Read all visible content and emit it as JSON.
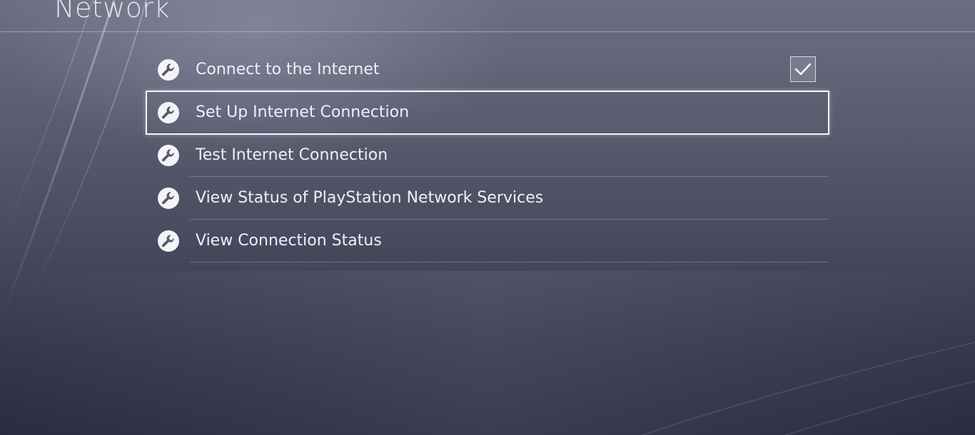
{
  "page": {
    "title": "Network"
  },
  "menu": {
    "items": [
      {
        "label": "Connect to the Internet",
        "icon": "wrench-icon",
        "checked": true
      },
      {
        "label": "Set Up Internet Connection",
        "icon": "wrench-icon",
        "selected": true
      },
      {
        "label": "Test Internet Connection",
        "icon": "wrench-icon"
      },
      {
        "label": "View Status of PlayStation Network Services",
        "icon": "wrench-icon"
      },
      {
        "label": "View Connection Status",
        "icon": "wrench-icon"
      }
    ]
  },
  "colors": {
    "background_top": "#6e6e82",
    "background_bottom": "#2c2c40",
    "text": "#eef0f6",
    "selection_border": "#f4f5f9"
  }
}
